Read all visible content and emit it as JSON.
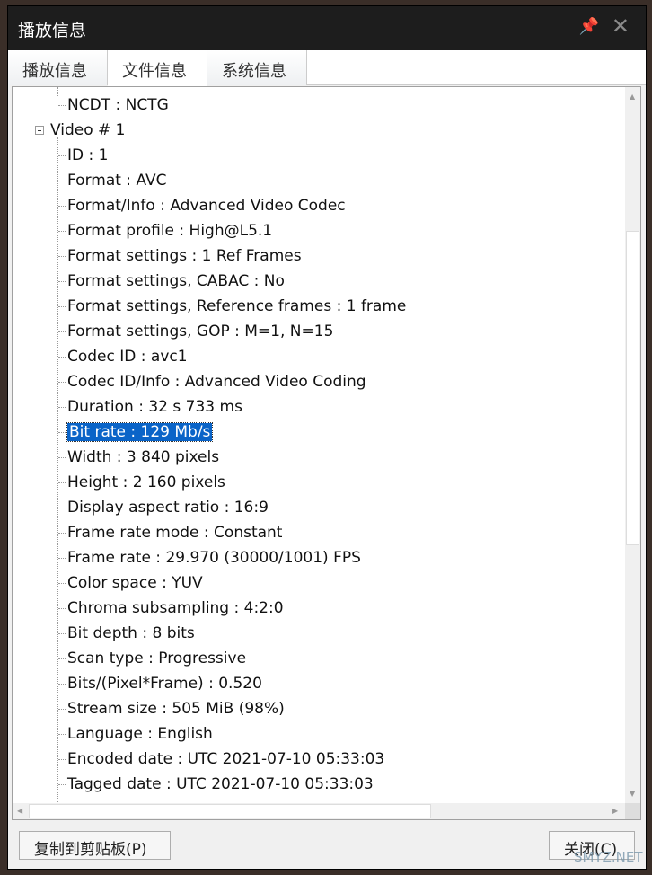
{
  "window": {
    "title": "播放信息"
  },
  "tabs": [
    {
      "label": "播放信息"
    },
    {
      "label": "文件信息",
      "active": true
    },
    {
      "label": "系统信息"
    }
  ],
  "tree": {
    "top_item": "NCDT : NCTG",
    "group": "Video # 1",
    "items": [
      "ID : 1",
      "Format : AVC",
      "Format/Info : Advanced Video Codec",
      "Format profile : High@L5.1",
      "Format settings : 1 Ref Frames",
      "Format settings, CABAC : No",
      "Format settings, Reference frames : 1 frame",
      "Format settings, GOP : M=1, N=15",
      "Codec ID : avc1",
      "Codec ID/Info : Advanced Video Coding",
      "Duration : 32 s 733 ms",
      "Bit rate : 129 Mb/s",
      "Width : 3 840 pixels",
      "Height : 2 160 pixels",
      "Display aspect ratio : 16:9",
      "Frame rate mode : Constant",
      "Frame rate : 29.970 (30000/1001) FPS",
      "Color space : YUV",
      "Chroma subsampling : 4:2:0",
      "Bit depth : 8 bits",
      "Scan type : Progressive",
      "Bits/(Pixel*Frame) : 0.520",
      "Stream size : 505 MiB (98%)",
      "Language : English",
      "Encoded date : UTC 2021-07-10 05:33:03",
      "Tagged date : UTC 2021-07-10 05:33:03"
    ],
    "selected_index": 11
  },
  "buttons": {
    "copy": "复制到剪贴板(P)",
    "close": "关闭(C)"
  },
  "watermark": "SMYZ.NET"
}
